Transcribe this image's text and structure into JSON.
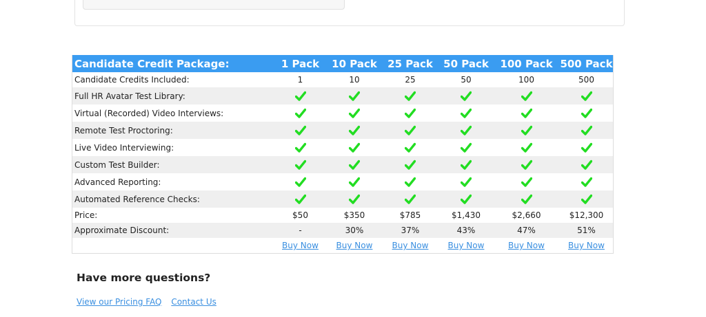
{
  "pricing": {
    "header_label": "Candidate Credit Package:",
    "packs": [
      "1 Pack",
      "10 Pack",
      "25 Pack",
      "50 Pack",
      "100 Pack",
      "500 Pack"
    ],
    "credits_label": "Candidate Credits Included:",
    "credits": [
      "1",
      "10",
      "25",
      "50",
      "100",
      "500"
    ],
    "features": [
      "Full HR Avatar Test Library:",
      "Virtual (Recorded) Video Interviews:",
      "Remote Test Proctoring:",
      "Live Video Interviewing:",
      "Custom Test Builder:",
      "Advanced Reporting:",
      "Automated Reference Checks:"
    ],
    "price_label": "Price:",
    "prices": [
      "$50",
      "$350",
      "$785",
      "$1,430",
      "$2,660",
      "$12,300"
    ],
    "discount_label": "Approximate Discount:",
    "discounts": [
      "-",
      "30%",
      "37%",
      "43%",
      "47%",
      "51%"
    ],
    "buy_label": "Buy Now"
  },
  "footer": {
    "questions_heading": "Have more questions?",
    "faq_link": "View our Pricing FAQ",
    "contact_link": "Contact Us"
  },
  "colors": {
    "header_bg": "#3a9cf1",
    "check": "#22dd22",
    "link": "#3a8fe0"
  },
  "icons": {
    "included": "check-icon"
  }
}
